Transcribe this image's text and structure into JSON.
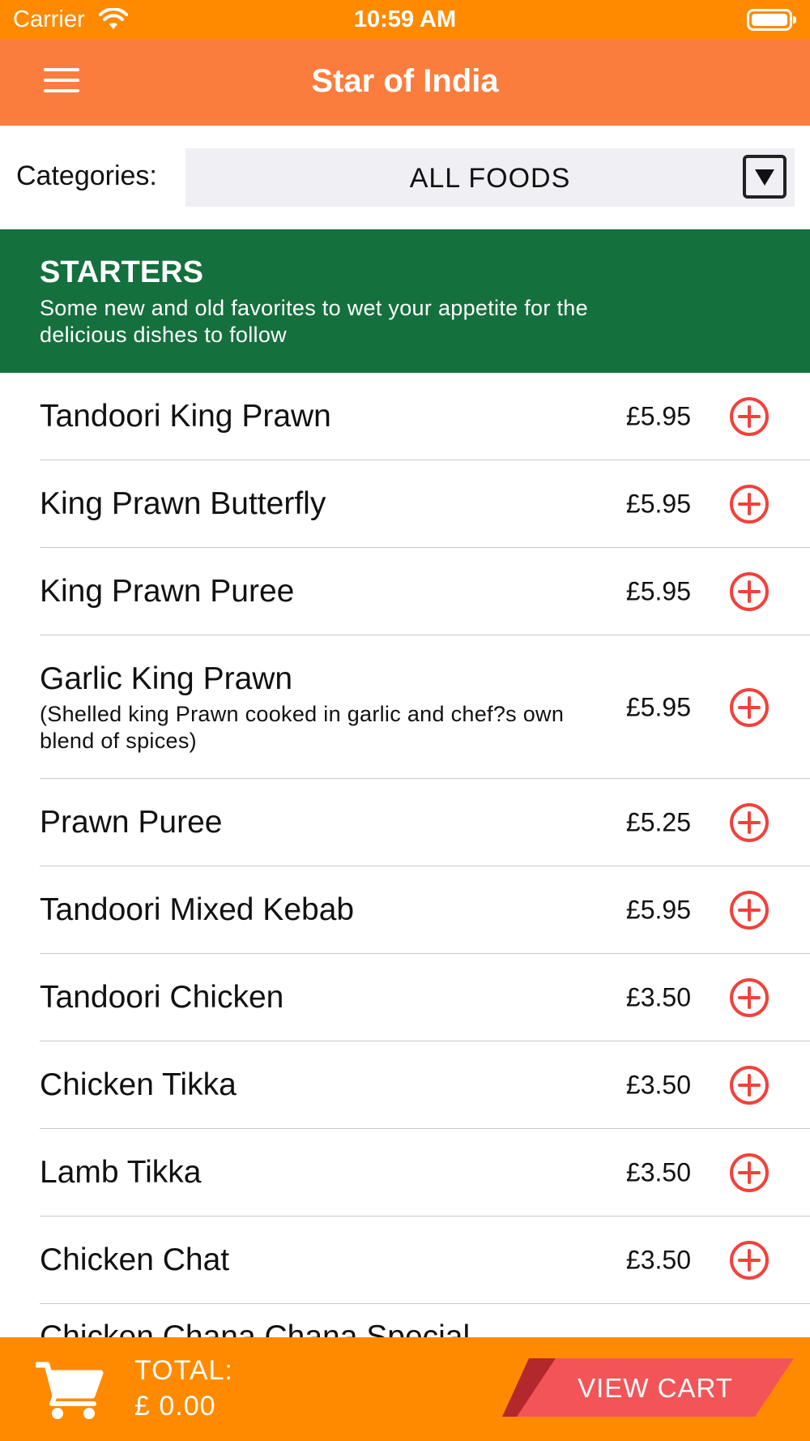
{
  "status_bar": {
    "carrier": "Carrier",
    "time": "10:59 AM",
    "wifi_icon": "wifi-icon",
    "battery_icon": "battery-icon"
  },
  "nav": {
    "title": "Star of India",
    "menu_icon": "hamburger-menu-icon"
  },
  "categories": {
    "label": "Categories:",
    "selected": "ALL FOODS",
    "dropdown_icon": "chevron-down-icon"
  },
  "section": {
    "title": "STARTERS",
    "description": "Some new and old favorites to wet your appetite for the delicious dishes to follow"
  },
  "menu_items": [
    {
      "name": "Tandoori King Prawn",
      "description": "",
      "price": "£5.95"
    },
    {
      "name": "King Prawn Butterfly",
      "description": "",
      "price": "£5.95"
    },
    {
      "name": "King Prawn Puree",
      "description": "",
      "price": "£5.95"
    },
    {
      "name": "Garlic King Prawn",
      "description": "(Shelled king Prawn cooked in garlic and chef?s own blend of spices)",
      "price": "£5.95"
    },
    {
      "name": "Prawn Puree",
      "description": "",
      "price": "£5.25"
    },
    {
      "name": "Tandoori Mixed Kebab",
      "description": "",
      "price": "£5.95"
    },
    {
      "name": "Tandoori Chicken",
      "description": "",
      "price": "£3.50"
    },
    {
      "name": "Chicken Tikka",
      "description": "",
      "price": "£3.50"
    },
    {
      "name": "Lamb Tikka",
      "description": "",
      "price": "£3.50"
    },
    {
      "name": "Chicken Chat",
      "description": "",
      "price": "£3.50"
    },
    {
      "name": "Chicken Chana Chana Special",
      "description": "",
      "price": ""
    }
  ],
  "add_icon": "add-circle-icon",
  "bottom_bar": {
    "cart_icon": "shopping-cart-icon",
    "total_label": "TOTAL:",
    "total_value": "£ 0.00",
    "view_cart_label": "VIEW CART"
  },
  "colors": {
    "status_bar": "#ff8a00",
    "nav_bar": "#fb7d3d",
    "section_header": "#14703d",
    "add_icon": "#f2413b",
    "view_cart": "#f25458"
  }
}
